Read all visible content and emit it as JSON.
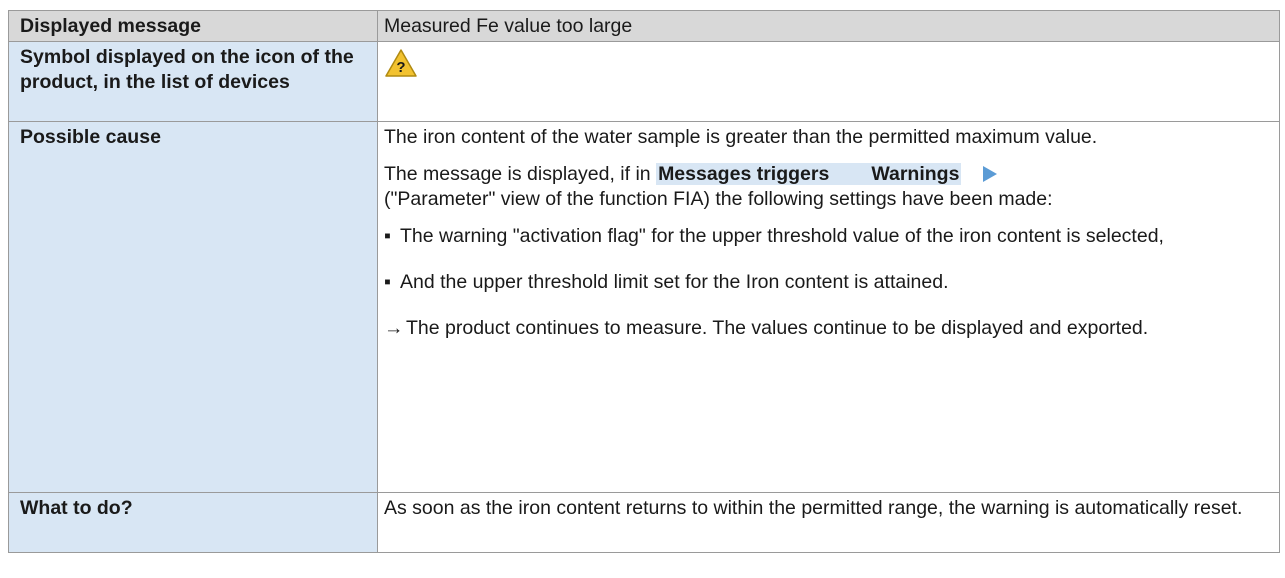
{
  "table": {
    "rows": [
      {
        "key": "Displayed message",
        "value": "Measured Fe value too large"
      },
      {
        "key": "Symbol displayed on the icon of the product, in the list of devices",
        "icon": "warning-question-icon",
        "icon_color": "#f2c230",
        "icon_glyph": "?"
      },
      {
        "key": "Possible cause"
      },
      {
        "key": "What to do?",
        "value": "As soon as the iron content returns to within the permitted range, the warning is automatically reset."
      }
    ]
  },
  "cause": {
    "intro": "The iron content of the water sample is greater than the permitted maximum value.",
    "msg_prefix": "The message is displayed, if in ",
    "menu_item_1": "Messages triggers",
    "menu_item_2": "Warnings",
    "msg_suffix": "(\"Parameter\" view of the function FIA) the following settings have been made:",
    "bullet_mark": "▪",
    "bullets": [
      "The warning \"activation flag\" for the upper threshold value of the iron content is selected,",
      "And the upper threshold limit set for the Iron content is attained."
    ],
    "result_mark": "→",
    "result": "The product continues to measure. The values continue to be displayed and exported."
  }
}
